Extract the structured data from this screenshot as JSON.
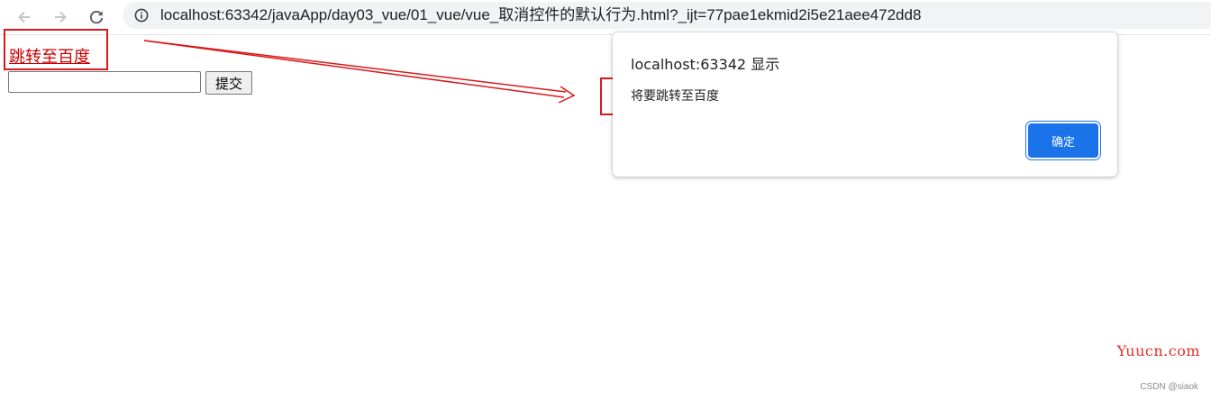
{
  "browser": {
    "url": "localhost:63342/javaApp/day03_vue/01_vue/vue_取消控件的默认行为.html?_ijt=77pae1ekmid2i5e21aee472dd8",
    "icons": [
      "back-arrow-icon",
      "forward-arrow-icon",
      "reload-icon",
      "info-icon"
    ]
  },
  "page": {
    "link_text": "跳转至百度",
    "input_value": "",
    "submit_label": "提交"
  },
  "dialog": {
    "title": "localhost:63342 显示",
    "message": "将要跳转至百度",
    "ok_label": "确定"
  },
  "overlay": {
    "watermark": "Yuucn.com",
    "credit": "CSDN @siaok"
  },
  "colors": {
    "annotation": "#d91a1a",
    "link": "#cc0000",
    "dialog_button": "#1a73e8"
  }
}
